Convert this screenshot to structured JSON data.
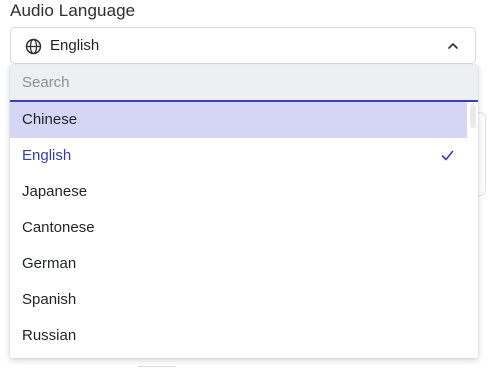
{
  "field": {
    "label": "Audio Language"
  },
  "select": {
    "value": "English",
    "icon": "globe-icon",
    "toggle_icon": "chevron-up-icon"
  },
  "search": {
    "placeholder": "Search",
    "value": ""
  },
  "options": [
    {
      "label": "Chinese",
      "state": "highlighted"
    },
    {
      "label": "English",
      "state": "selected"
    },
    {
      "label": "Japanese",
      "state": ""
    },
    {
      "label": "Cantonese",
      "state": ""
    },
    {
      "label": "German",
      "state": ""
    },
    {
      "label": "Spanish",
      "state": ""
    },
    {
      "label": "Russian",
      "state": ""
    }
  ],
  "colors": {
    "accent": "#3b3fb5",
    "highlight": "#d5d6f5",
    "search_bg": "#edeff0"
  }
}
